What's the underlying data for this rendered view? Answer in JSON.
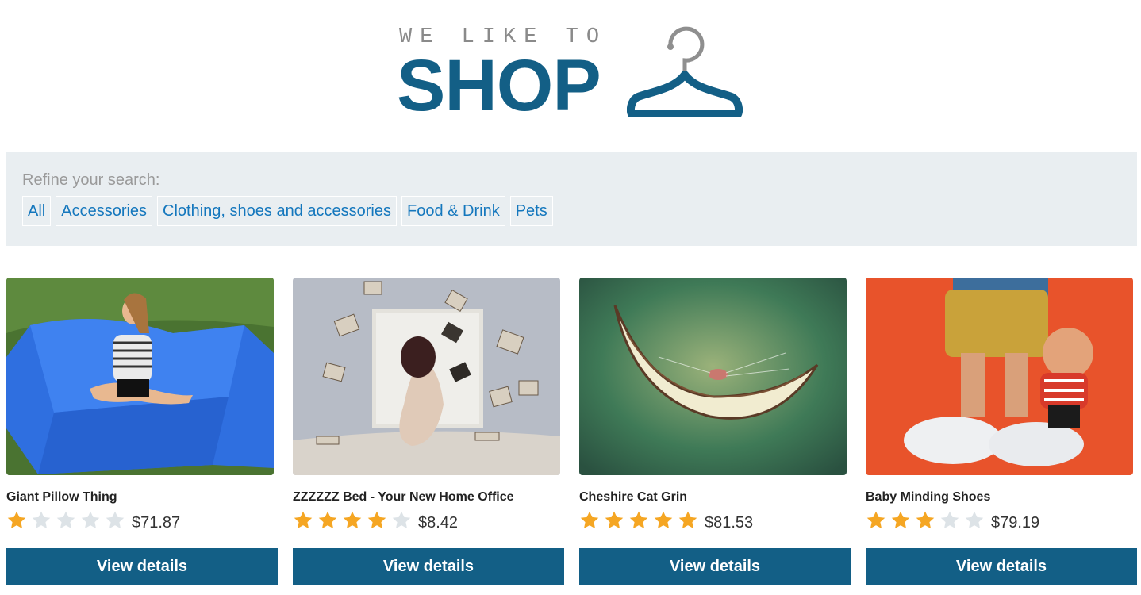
{
  "header": {
    "tagline": "WE LIKE TO",
    "brand": "SHOP",
    "logo_icon": "hanger-icon",
    "brand_color": "#135f86"
  },
  "filters": {
    "label": "Refine your search:",
    "options": [
      "All",
      "Accessories",
      "Clothing, shoes and accessories",
      "Food & Drink",
      "Pets"
    ]
  },
  "colors": {
    "accent": "#135f86",
    "link": "#1477bd",
    "star_filled": "#f5a623",
    "star_empty": "#dde3e7",
    "panel_bg": "#e9eef1"
  },
  "products": [
    {
      "name": "Giant Pillow Thing",
      "rating": 1,
      "max_rating": 5,
      "price": "$71.87",
      "button": "View details",
      "image": "blue-beanbag-girl-photo"
    },
    {
      "name": "ZZZZZZ Bed - Your New Home Office",
      "rating": 4,
      "max_rating": 5,
      "price": "$8.42",
      "button": "View details",
      "image": "flying-books-bed-photo"
    },
    {
      "name": "Cheshire Cat Grin",
      "rating": 5,
      "max_rating": 5,
      "price": "$81.53",
      "button": "View details",
      "image": "cheshire-grin-photo"
    },
    {
      "name": "Baby Minding Shoes",
      "rating": 3,
      "max_rating": 5,
      "price": "$79.19",
      "button": "View details",
      "image": "baby-shoes-figurine-photo"
    }
  ]
}
